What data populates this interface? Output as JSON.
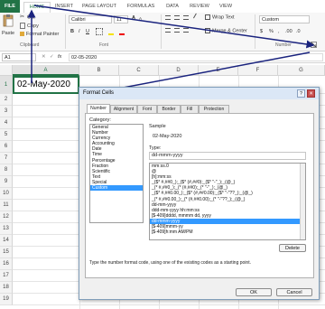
{
  "ribbon_tabs": [
    "FILE",
    "HOME",
    "INSERT",
    "PAGE LAYOUT",
    "FORMULAS",
    "DATA",
    "REVIEW",
    "VIEW"
  ],
  "clipboard": {
    "cut": "Cut",
    "copy": "Copy",
    "paste": "Paste",
    "format_painter": "Format Painter",
    "group": "Clipboard"
  },
  "font": {
    "name": "Calibri",
    "size": "11",
    "group": "Font",
    "bold": "B",
    "italic": "I",
    "underline": "U",
    "grow": "A",
    "shrink": "A"
  },
  "alignment": {
    "wrap_text": "Wrap Text",
    "merge": "Merge & Center"
  },
  "number": {
    "format": "Custom",
    "currency": "$",
    "percent": "%",
    "comma": ",",
    "group": "Number"
  },
  "formula_bar": {
    "name_box": "A1",
    "fx": "fx",
    "value": "02-05-2020"
  },
  "grid": {
    "columns": [
      "A",
      "B",
      "C",
      "D",
      "E",
      "F",
      "G"
    ],
    "rows": [
      "1",
      "2",
      "3",
      "4",
      "5",
      "6",
      "7",
      "8",
      "9",
      "10",
      "11",
      "12",
      "13",
      "14",
      "15",
      "16",
      "17",
      "18",
      "19"
    ],
    "a1_value": "02-May-2020"
  },
  "dialog": {
    "title": "Format Cells",
    "help": "?",
    "close": "✕",
    "tabs": [
      "Number",
      "Alignment",
      "Font",
      "Border",
      "Fill",
      "Protection"
    ],
    "category_label": "Category:",
    "categories": [
      "General",
      "Number",
      "Currency",
      "Accounting",
      "Date",
      "Time",
      "Percentage",
      "Fraction",
      "Scientific",
      "Text",
      "Special",
      "Custom"
    ],
    "selected_category": "Custom",
    "sample_label": "Sample",
    "sample_value": "02-May-2020",
    "type_label": "Type:",
    "type_value": "dd-mmm-yyyy",
    "type_list": [
      "mm:ss.0",
      "@",
      "[h]:mm:ss",
      "_($* #,##0_);_($* (#,##0);_($* \"-\"_);_(@_)",
      "_(* #,##0_);_(* (#,##0);_(* \"-\"_);_(@_)",
      "_($* #,##0.00_);_($* (#,##0.00);_($* \"-\"??_);_(@_)",
      "_(* #,##0.00_);_(* (#,##0.00);_(* \"-\"??_);_(@_)",
      "dd-mm-yyyy",
      "ddd-mm-yyyy hh:mm:ss",
      "[$-409]dddd, mmmm dd, yyyy",
      "dd-mmm-yyyy",
      "[$-409]mmm-yy",
      "[$-409]h:mm AM/PM"
    ],
    "selected_type": "dd-mmm-yyyy",
    "delete": "Delete",
    "hint": "Type the number format code, using one of the existing codes as a starting point.",
    "ok": "OK",
    "cancel": "Cancel"
  },
  "colors": {
    "excel_green": "#217346",
    "arrow": "#1a237e",
    "selection": "#3399ff"
  }
}
